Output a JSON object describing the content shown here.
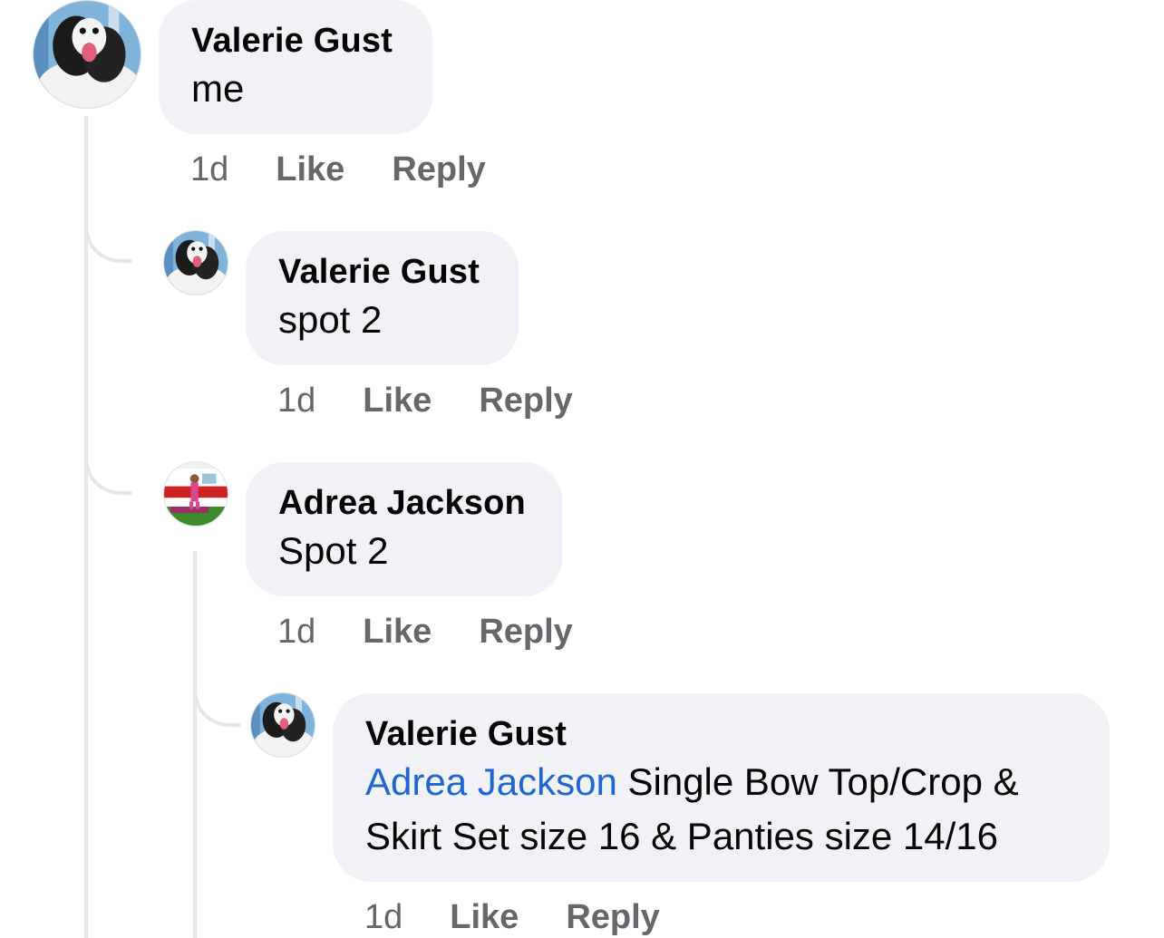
{
  "comments": [
    {
      "author": "Valerie Gust",
      "text": "me",
      "time": "1d",
      "like_label": "Like",
      "reply_label": "Reply",
      "avatar_icon": "dog-avatar"
    },
    {
      "author": "Valerie Gust",
      "text": "spot 2",
      "time": "1d",
      "like_label": "Like",
      "reply_label": "Reply",
      "avatar_icon": "dog-avatar"
    },
    {
      "author": "Adrea Jackson",
      "text": "Spot 2",
      "time": "1d",
      "like_label": "Like",
      "reply_label": "Reply",
      "avatar_icon": "child-camper-avatar"
    },
    {
      "author": "Valerie Gust",
      "mention": "Adrea Jackson",
      "text_line1": " Single Bow Top/Crop &",
      "text_line2": "Skirt Set size 16 & Panties size 14/16",
      "time": "1d",
      "like_label": "Like",
      "reply_label": "Reply",
      "avatar_icon": "dog-avatar"
    }
  ],
  "colors": {
    "bubble": "#f0f2f5",
    "thread_line": "#e4e6eb",
    "meta_text": "#65676b",
    "mention": "#1f66d1"
  }
}
